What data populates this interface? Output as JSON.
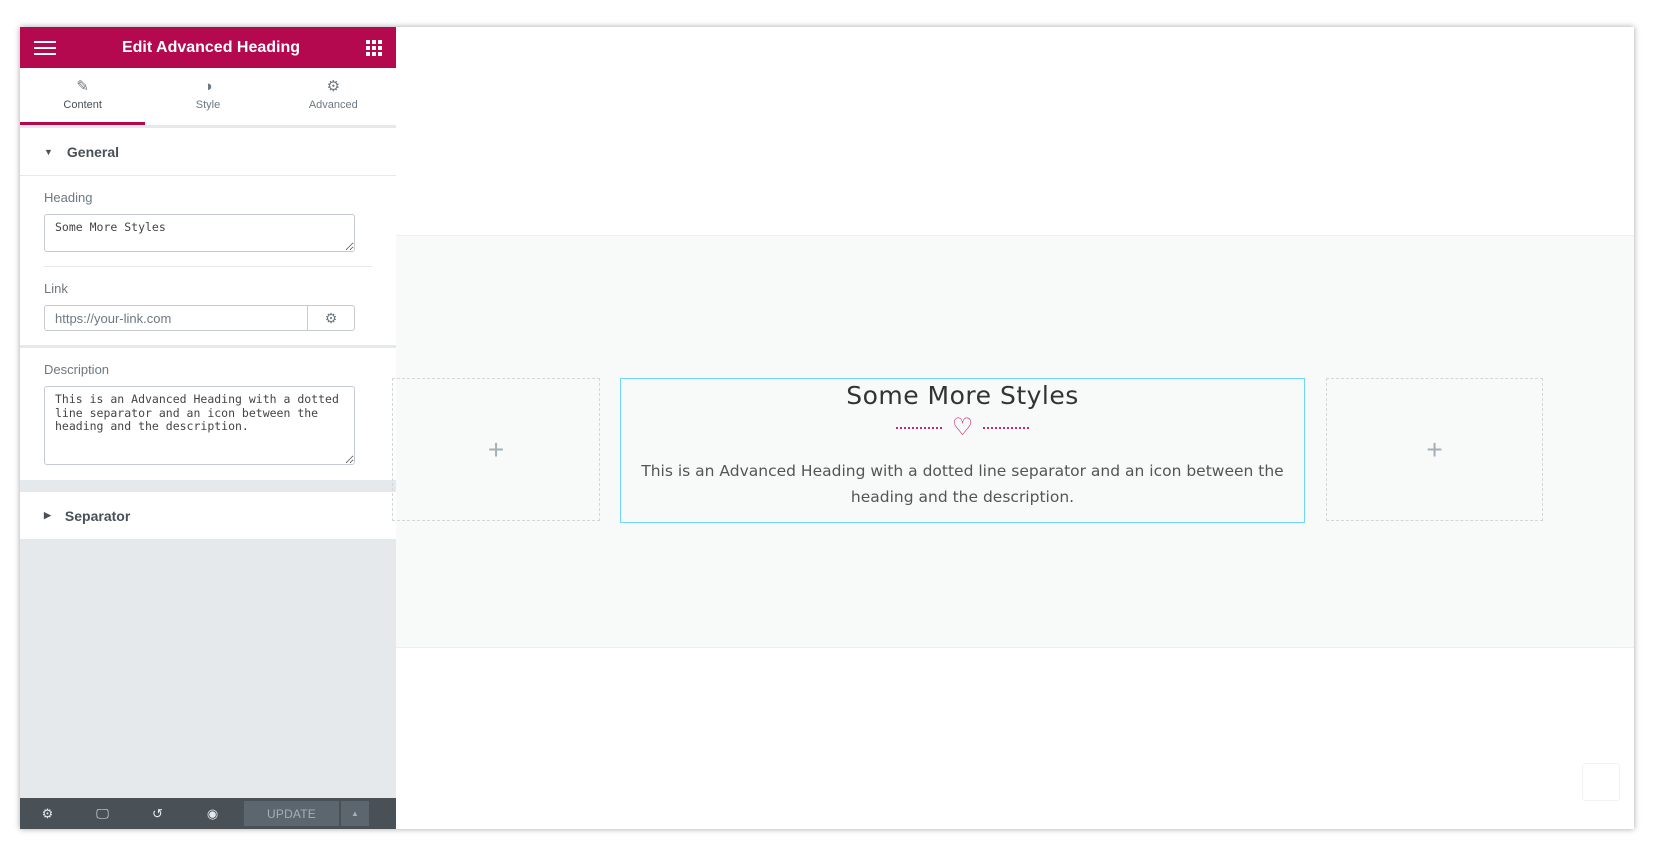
{
  "panel": {
    "title": "Edit Advanced Heading",
    "tabs": [
      {
        "label": "Content",
        "icon": "pencil-icon"
      },
      {
        "label": "Style",
        "icon": "half-circle-icon"
      },
      {
        "label": "Advanced",
        "icon": "gear-icon"
      }
    ],
    "sections": {
      "general": "General",
      "separator": "Separator"
    },
    "heading": {
      "label": "Heading",
      "value": "Some More Styles"
    },
    "link": {
      "label": "Link",
      "placeholder": "https://your-link.com"
    },
    "description": {
      "label": "Description",
      "value": "This is an Advanced Heading with a dotted line separator and an icon between the heading and the description."
    },
    "footer": {
      "update_label": "UPDATE"
    }
  },
  "canvas": {
    "widget_heading": "Some More Styles",
    "widget_description": "This is an Advanced Heading with a dotted line separator and an icon between the heading and the description.",
    "add_symbol": "+",
    "separator_icon": "heart-icon",
    "accent_color": "#c7286c"
  },
  "colors": {
    "brand": "#b5094f",
    "panel_bg": "#e6e9ec",
    "footer_bg": "#495157",
    "widget_outline": "#71d7f7"
  }
}
